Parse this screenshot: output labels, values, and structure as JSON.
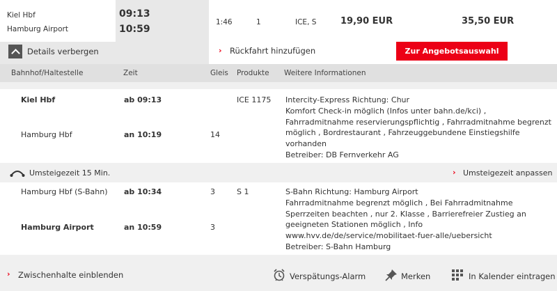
{
  "summary": {
    "from": "Kiel Hbf",
    "to": "Hamburg Airport",
    "dep_time": "09:13",
    "arr_time": "10:59",
    "duration": "1:46",
    "changes": "1",
    "products": "ICE, S",
    "price_1": "19,90 EUR",
    "price_2": "35,50 EUR",
    "details_toggle": "Details verbergen",
    "return_trip": "Rückfahrt hinzufügen",
    "offer_button": "Zur Angebotsauswahl"
  },
  "columns": [
    "Bahnhof/Haltestelle",
    "Zeit",
    "Gleis",
    "Produkte",
    "Weitere Informationen"
  ],
  "legs": [
    {
      "dep_station": "Kiel Hbf",
      "dep_time": "ab 09:13",
      "dep_platform": "",
      "product": "ICE 1175",
      "arr_station": "Hamburg Hbf",
      "arr_time": "an 10:19",
      "arr_platform": "14",
      "info": [
        "Intercity-Express Richtung: Chur",
        "Komfort Check-in möglich (Infos unter bahn.de/kci) ,",
        "Fahrradmitnahme reservierungspflichtig , Fahrradmitnahme begrenzt",
        "möglich , Bordrestaurant , Fahrzeuggebundene Einstiegshilfe",
        "vorhanden",
        "Betreiber: DB Fernverkehr AG"
      ]
    },
    {
      "dep_station": "Hamburg Hbf (S-Bahn)",
      "dep_time": "ab 10:34",
      "dep_platform": "3",
      "product": "S 1",
      "arr_station": "Hamburg Airport",
      "arr_time": "an 10:59",
      "arr_platform": "3",
      "info": [
        "S-Bahn Richtung: Hamburg Airport",
        "Fahrradmitnahme begrenzt möglich , Bei Fahrradmitnahme",
        "Sperrzeiten beachten , nur 2. Klasse , Barrierefreier Zustieg an",
        "geeigneten Stationen möglich , Info",
        "www.hvv.de/de/service/mobilitaet-fuer-alle/uebersicht",
        "Betreiber: S-Bahn Hamburg"
      ]
    }
  ],
  "transfer": {
    "label": "Umsteigezeit 15 Min.",
    "adjust": "Umsteigezeit anpassen"
  },
  "footer": {
    "intermediate": "Zwischenhalte einblenden",
    "delay_alarm": "Verspätungs-Alarm",
    "bookmark": "Merken",
    "calendar": "In Kalender eintragen"
  },
  "colors": {
    "accent": "#ec0016"
  }
}
